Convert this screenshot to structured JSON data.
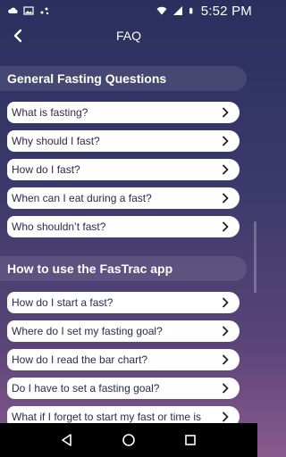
{
  "status_bar": {
    "time": "5:52 PM",
    "left_icons": [
      "cloud-icon",
      "image-icon",
      "dots-icon"
    ],
    "right_icons": [
      "wifi-icon",
      "signal-icon",
      "battery-icon"
    ]
  },
  "app_bar": {
    "title": "FAQ",
    "back_icon": "chevron-left-icon"
  },
  "sections": [
    {
      "title": "General Fasting Questions",
      "items": [
        "What is fasting?",
        "Why should I fast?",
        "How do I fast?",
        "When can I eat during a fast?",
        "Who shouldn’t fast?"
      ]
    },
    {
      "title": "How to use the FasTrac app",
      "items": [
        "How do I start a fast?",
        "Where do I set my fasting goal?",
        "How do I read the bar chart?",
        "Do I have to set a fasting goal?",
        "What if I forget to start my fast or time is"
      ]
    }
  ],
  "nav_bar": {
    "icons": [
      "back-triangle-icon",
      "home-circle-icon",
      "recents-square-icon"
    ]
  },
  "colors": {
    "background_top": "#2a2f5e",
    "background_bottom": "#8a5a8e",
    "item_background": "#ffffff",
    "item_text": "#2a2a4a"
  }
}
